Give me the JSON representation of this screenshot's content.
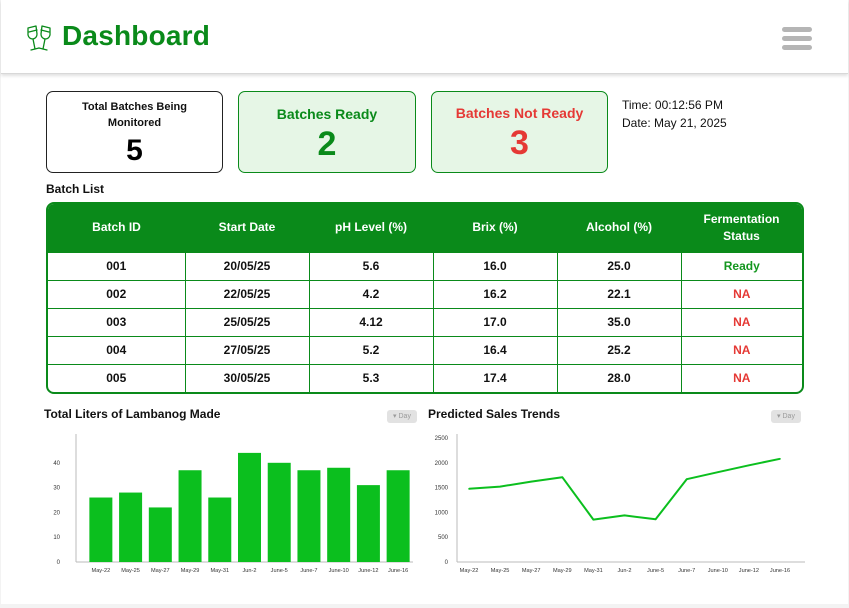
{
  "header": {
    "title": "Dashboard",
    "colors": {
      "brand": "#0a8a1a",
      "danger": "#e53935"
    }
  },
  "stats": {
    "total": {
      "label": "Total Batches Being Monitored",
      "value": "5"
    },
    "ready": {
      "label": "Batches Ready",
      "value": "2"
    },
    "not_ready": {
      "label": "Batches Not Ready",
      "value": "3"
    }
  },
  "clock": {
    "time": "Time: 00:12:56 PM",
    "date": "Date: May 21, 2025"
  },
  "batch_list": {
    "title": "Batch List",
    "columns": [
      "Batch ID",
      "Start Date",
      "pH Level (%)",
      "Brix (%)",
      "Alcohol (%)",
      "Fermentation Status"
    ],
    "rows": [
      {
        "id": "001",
        "start": "20/05/25",
        "ph": "5.6",
        "brix": "16.0",
        "alcohol": "25.0",
        "status": "Ready"
      },
      {
        "id": "002",
        "start": "22/05/25",
        "ph": "4.2",
        "brix": "16.2",
        "alcohol": "22.1",
        "status": "NA"
      },
      {
        "id": "003",
        "start": "25/05/25",
        "ph": "4.12",
        "brix": "17.0",
        "alcohol": "35.0",
        "status": "NA"
      },
      {
        "id": "004",
        "start": "27/05/25",
        "ph": "5.2",
        "brix": "16.4",
        "alcohol": "25.2",
        "status": "NA"
      },
      {
        "id": "005",
        "start": "30/05/25",
        "ph": "5.3",
        "brix": "17.4",
        "alcohol": "28.0",
        "status": "NA"
      }
    ]
  },
  "charts": {
    "liters": {
      "title": "Total Liters of Lambanog Made",
      "dropdown": "▾ Day"
    },
    "sales": {
      "title": "Predicted Sales Trends",
      "dropdown": "▾ Day"
    }
  },
  "chart_data": [
    {
      "type": "bar",
      "title": "Total Liters of Lambanog Made",
      "categories": [
        "May-22",
        "May-25",
        "May-27",
        "May-29",
        "May-31",
        "Jun-2",
        "June-5",
        "June-7",
        "June-10",
        "June-12",
        "June-16"
      ],
      "values": [
        26,
        28,
        22,
        37,
        26,
        44,
        40,
        37,
        38,
        31,
        37
      ],
      "ylim": [
        0,
        50
      ],
      "yticks": [
        0,
        10,
        20,
        30,
        40
      ],
      "color": "#0bbf1e"
    },
    {
      "type": "line",
      "title": "Predicted Sales Trends",
      "categories": [
        "May-22",
        "May-25",
        "May-27",
        "May-29",
        "May-31",
        "Jun-2",
        "June-5",
        "June-7",
        "June-10",
        "June-12",
        "June-16"
      ],
      "values": [
        1475,
        1520,
        1620,
        1710,
        855,
        940,
        860,
        1670,
        1810,
        1950,
        2080
      ],
      "ylim": [
        0,
        2500
      ],
      "yticks": [
        0,
        500,
        1000,
        1500,
        2000,
        2500
      ],
      "color": "#0bbf1e"
    }
  ]
}
